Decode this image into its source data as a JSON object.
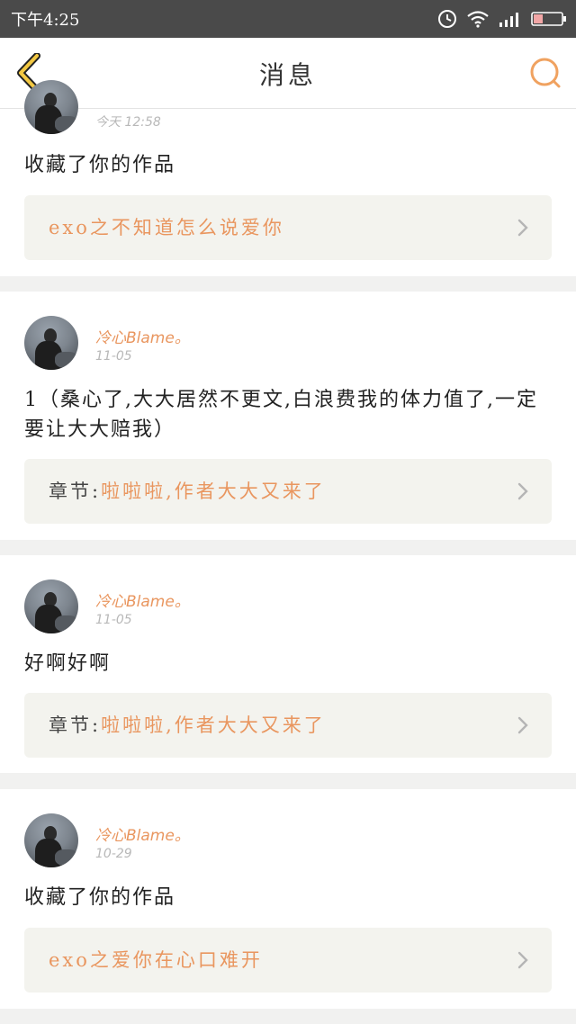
{
  "status_bar": {
    "time": "下午4:25"
  },
  "nav": {
    "title": "消息"
  },
  "icons": {
    "back": "chevron-left-icon",
    "search": "search-icon",
    "alarm": "alarm-icon",
    "wifi": "wifi-icon",
    "signal": "signal-icon",
    "battery": "battery-icon"
  },
  "colors": {
    "accent": "#e9965f",
    "link_bg": "#f3f3ee",
    "status_bar": "#4a4a4a"
  },
  "messages": [
    {
      "date": "今天 12:58",
      "text": "收藏了你的作品",
      "link_prefix": "",
      "link_title": "exo之不知道怎么说爱你"
    },
    {
      "username": "冷心Blame。",
      "date": "11-05",
      "text": "1（桑心了,大大居然不更文,白浪费我的体力值了,一定要让大大赔我）",
      "link_prefix": "章节:",
      "link_title": "啦啦啦,作者大大又来了"
    },
    {
      "username": "冷心Blame。",
      "date": "11-05",
      "text": "好啊好啊",
      "link_prefix": "章节:",
      "link_title": "啦啦啦,作者大大又来了"
    },
    {
      "username": "冷心Blame。",
      "date": "10-29",
      "text": "收藏了你的作品",
      "link_prefix": "",
      "link_title": "exo之爱你在心口难开"
    }
  ]
}
